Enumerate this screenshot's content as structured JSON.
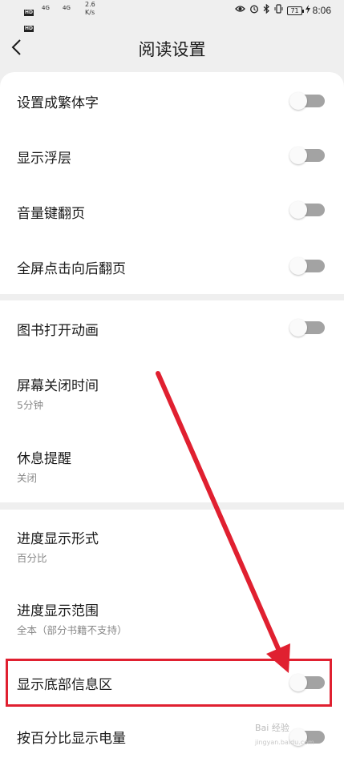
{
  "status_bar": {
    "hd": "HD",
    "signal": "4G",
    "net_speed_value": "2.6",
    "net_speed_unit": "K/s",
    "battery": "71",
    "time": "8:06"
  },
  "header": {
    "title": "阅读设置"
  },
  "settings": [
    {
      "label": "设置成繁体字",
      "toggle": "off"
    },
    {
      "label": "显示浮层",
      "toggle": "off"
    },
    {
      "label": "音量键翻页",
      "toggle": "off"
    },
    {
      "label": "全屏点击向后翻页",
      "toggle": "off"
    },
    {
      "label": "图书打开动画",
      "toggle": "off"
    },
    {
      "label": "屏幕关闭时间",
      "value": "5分钟"
    },
    {
      "label": "休息提醒",
      "value": "关闭"
    },
    {
      "label": "进度显示形式",
      "value": "百分比"
    },
    {
      "label": "进度显示范围",
      "value": "全本（部分书籍不支持）"
    },
    {
      "label": "显示底部信息区",
      "toggle": "off"
    },
    {
      "label": "按百分比显示电量",
      "toggle": "off"
    }
  ],
  "watermark": {
    "brand": "Bai 经验",
    "url": "jingyan.baidu.com"
  },
  "colors": {
    "annotation_red": "#e02030",
    "toggle_off": "#a3a3a3",
    "background": "#efefef"
  }
}
